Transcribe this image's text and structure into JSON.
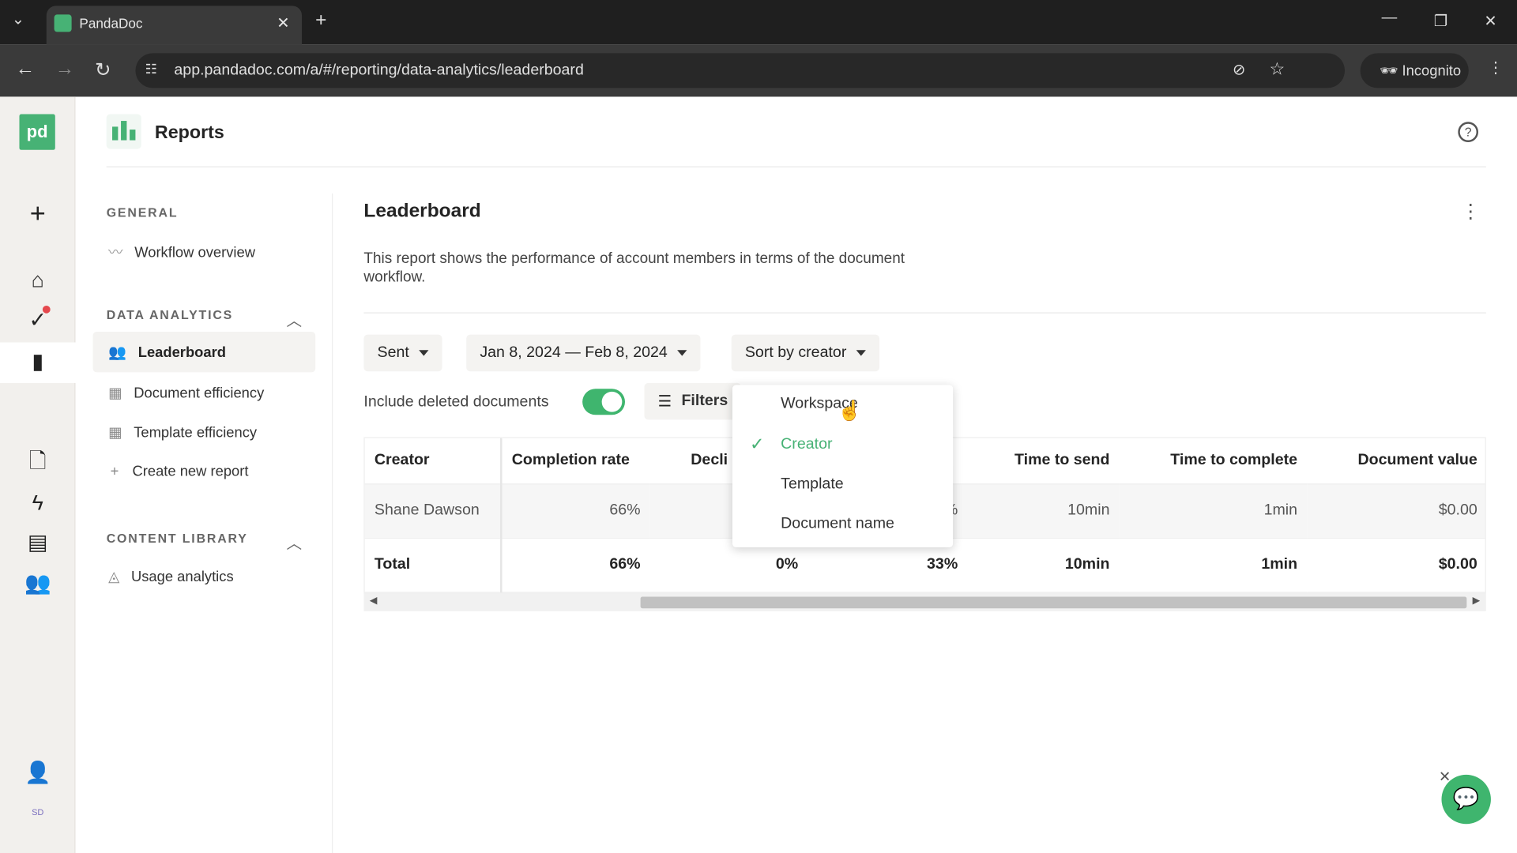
{
  "browser": {
    "tab_title": "PandaDoc",
    "url": "app.pandadoc.com/a/#/reporting/data-analytics/leaderboard",
    "incognito_label": "Incognito"
  },
  "header": {
    "title": "Reports"
  },
  "sidebar": {
    "general_label": "GENERAL",
    "general_items": [
      {
        "label": "Workflow overview"
      }
    ],
    "data_analytics_label": "DATA ANALYTICS",
    "data_analytics_items": [
      {
        "label": "Leaderboard",
        "active": true
      },
      {
        "label": "Document efficiency"
      },
      {
        "label": "Template efficiency"
      },
      {
        "label": "Create new report"
      }
    ],
    "content_library_label": "CONTENT LIBRARY",
    "content_library_items": [
      {
        "label": "Usage analytics"
      }
    ]
  },
  "rail": {
    "avatar_initials": "SD"
  },
  "main": {
    "title": "Leaderboard",
    "description": "This report shows the performance of account members in terms of the document workflow.",
    "status_filter": "Sent",
    "date_range": "Jan 8, 2024 — Feb 8, 2024",
    "sort_label": "Sort by creator",
    "include_deleted_label": "Include deleted documents",
    "include_deleted": true,
    "filters_label": "Filters",
    "sort_options": [
      {
        "label": "Workspace"
      },
      {
        "label": "Creator",
        "selected": true
      },
      {
        "label": "Template"
      },
      {
        "label": "Document name"
      }
    ],
    "table": {
      "headers": [
        "Creator",
        "Completion rate",
        "Decli",
        "",
        "Time to send",
        "Time to complete",
        "Document value"
      ],
      "rows": [
        [
          "Shane Dawson",
          "66%",
          "",
          "%",
          "10min",
          "1min",
          "$0.00"
        ]
      ],
      "total": [
        "Total",
        "66%",
        "0%",
        "33%",
        "10min",
        "1min",
        "$0.00"
      ]
    }
  },
  "colors": {
    "brand": "#47b275",
    "toggle": "#3fb56e"
  }
}
